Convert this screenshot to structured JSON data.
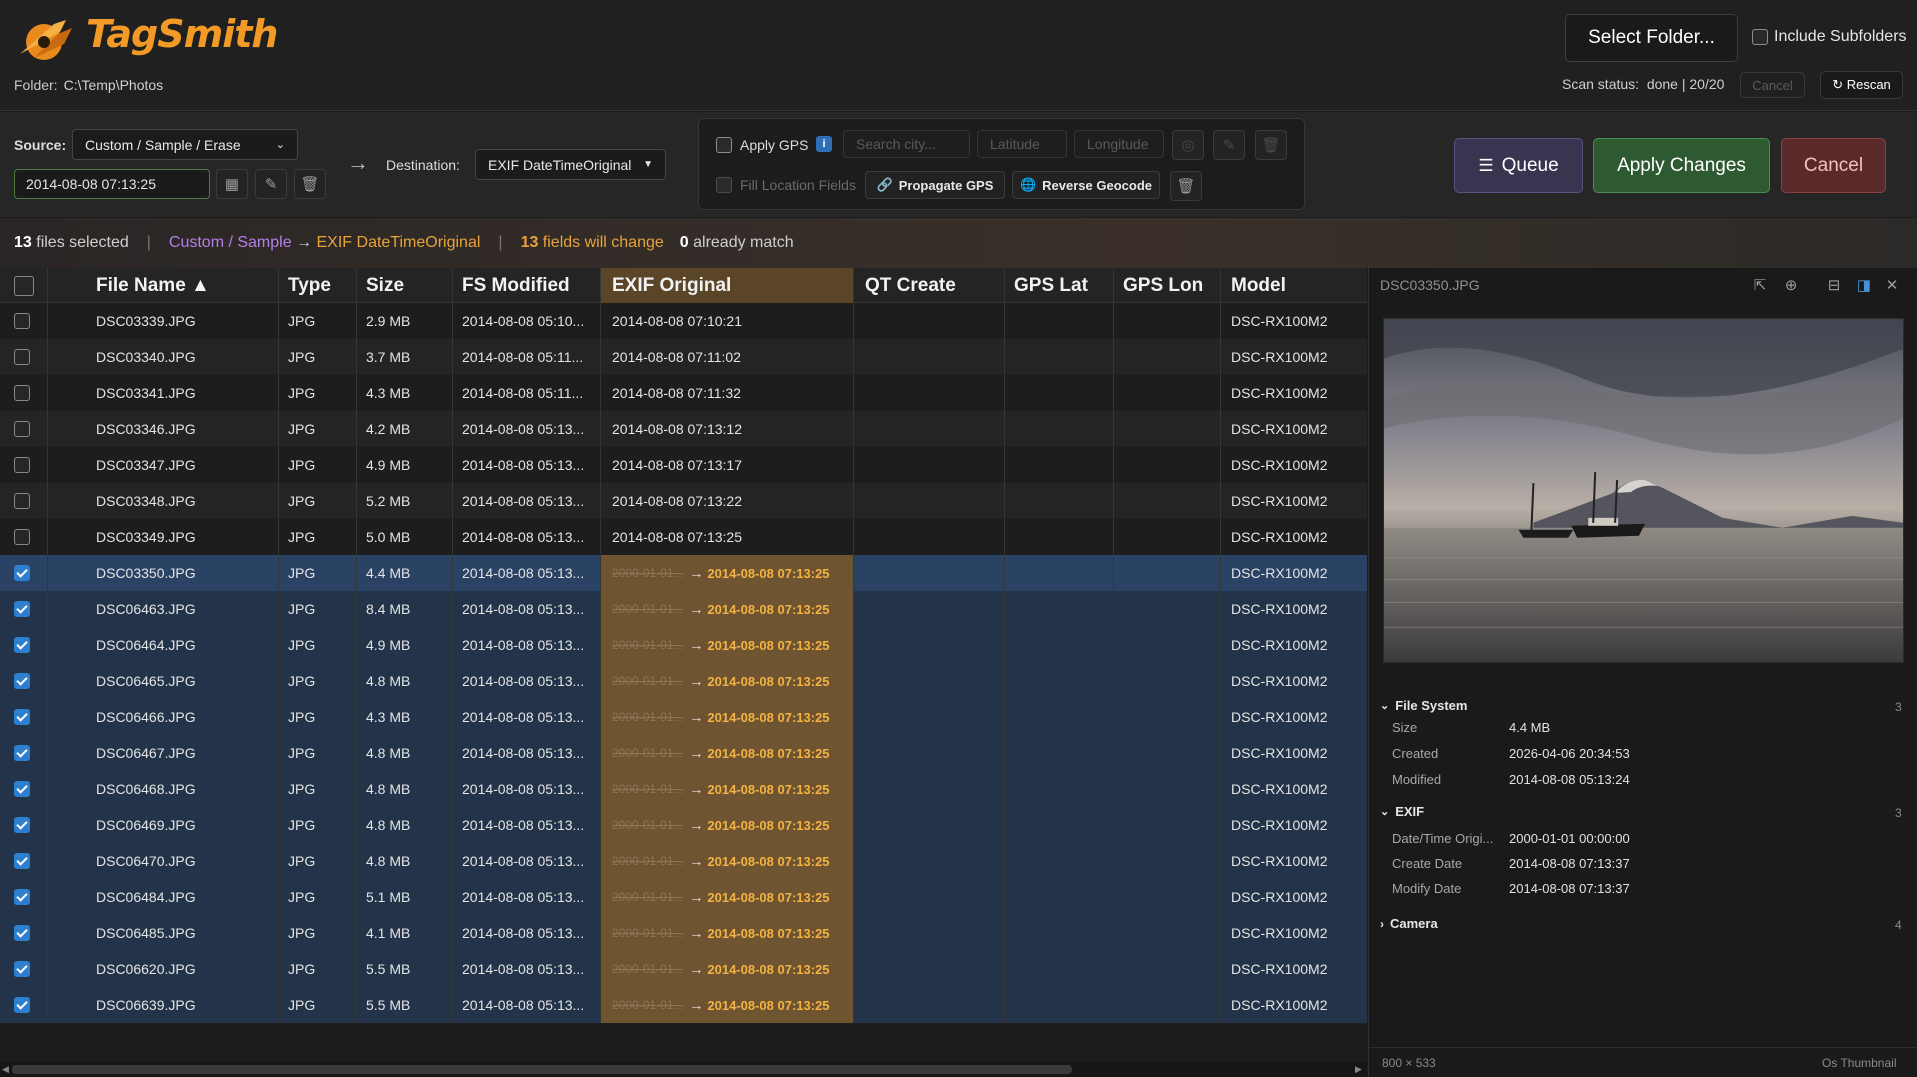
{
  "header": {
    "app_name": "TagSmith",
    "folder_label": "Folder:",
    "folder_path": "C:\\Temp\\Photos",
    "select_folder": "Select Folder...",
    "include_subfolders": "Include Subfolders",
    "scan_status": "Scan status:  done | 20/20",
    "scan_cancel": "Cancel",
    "rescan": "↻ Rescan"
  },
  "toolbar": {
    "source_label": "Source:",
    "source_value": "Custom / Sample / Erase",
    "date_value": "2014-08-08 07:13:25",
    "destination_label": "Destination:",
    "destination_value": "EXIF DateTimeOriginal",
    "apply_gps": "Apply GPS",
    "search_city": "Search city...",
    "latitude": "Latitude",
    "longitude": "Longitude",
    "fill_location": "Fill Location Fields",
    "propagate_gps": "Propagate GPS",
    "reverse_geocode": "Reverse Geocode",
    "queue": "Queue",
    "apply_changes": "Apply Changes",
    "cancel": "Cancel"
  },
  "summary": {
    "files_selected_count": "13",
    "files_selected_text": " files selected",
    "mapping_source": "Custom / Sample",
    "mapping_arrow": " → ",
    "mapping_dest": "EXIF DateTimeOriginal",
    "fields_change_count": "13",
    "fields_change_text": " fields will change",
    "match_count": "0",
    "match_text": " already match"
  },
  "table": {
    "columns": [
      "File Name ▲",
      "Type",
      "Size",
      "FS Modified",
      "EXIF Original",
      "QT Create",
      "GPS Lat",
      "GPS Lon",
      "Model"
    ],
    "old_value_prefix": "2000-01-01...",
    "new_value": "2014-08-08 07:13:25",
    "rows": [
      {
        "name": "DSC03339.JPG",
        "type": "JPG",
        "size": "2.9 MB",
        "fs": "2014-08-08 05:10...",
        "exif": "2014-08-08 07:10:21",
        "model": "DSC-RX100M2",
        "checked": false
      },
      {
        "name": "DSC03340.JPG",
        "type": "JPG",
        "size": "3.7 MB",
        "fs": "2014-08-08 05:11...",
        "exif": "2014-08-08 07:11:02",
        "model": "DSC-RX100M2",
        "checked": false
      },
      {
        "name": "DSC03341.JPG",
        "type": "JPG",
        "size": "4.3 MB",
        "fs": "2014-08-08 05:11...",
        "exif": "2014-08-08 07:11:32",
        "model": "DSC-RX100M2",
        "checked": false
      },
      {
        "name": "DSC03346.JPG",
        "type": "JPG",
        "size": "4.2 MB",
        "fs": "2014-08-08 05:13...",
        "exif": "2014-08-08 07:13:12",
        "model": "DSC-RX100M2",
        "checked": false
      },
      {
        "name": "DSC03347.JPG",
        "type": "JPG",
        "size": "4.9 MB",
        "fs": "2014-08-08 05:13...",
        "exif": "2014-08-08 07:13:17",
        "model": "DSC-RX100M2",
        "checked": false
      },
      {
        "name": "DSC03348.JPG",
        "type": "JPG",
        "size": "5.2 MB",
        "fs": "2014-08-08 05:13...",
        "exif": "2014-08-08 07:13:22",
        "model": "DSC-RX100M2",
        "checked": false
      },
      {
        "name": "DSC03349.JPG",
        "type": "JPG",
        "size": "5.0 MB",
        "fs": "2014-08-08 05:13...",
        "exif": "2014-08-08 07:13:25",
        "model": "DSC-RX100M2",
        "checked": false
      },
      {
        "name": "DSC03350.JPG",
        "type": "JPG",
        "size": "4.4 MB",
        "fs": "2014-08-08 05:13...",
        "exif": "change",
        "model": "DSC-RX100M2",
        "checked": true
      },
      {
        "name": "DSC06463.JPG",
        "type": "JPG",
        "size": "8.4 MB",
        "fs": "2014-08-08 05:13...",
        "exif": "change",
        "model": "DSC-RX100M2",
        "checked": true
      },
      {
        "name": "DSC06464.JPG",
        "type": "JPG",
        "size": "4.9 MB",
        "fs": "2014-08-08 05:13...",
        "exif": "change",
        "model": "DSC-RX100M2",
        "checked": true
      },
      {
        "name": "DSC06465.JPG",
        "type": "JPG",
        "size": "4.8 MB",
        "fs": "2014-08-08 05:13...",
        "exif": "change",
        "model": "DSC-RX100M2",
        "checked": true
      },
      {
        "name": "DSC06466.JPG",
        "type": "JPG",
        "size": "4.3 MB",
        "fs": "2014-08-08 05:13...",
        "exif": "change",
        "model": "DSC-RX100M2",
        "checked": true
      },
      {
        "name": "DSC06467.JPG",
        "type": "JPG",
        "size": "4.8 MB",
        "fs": "2014-08-08 05:13...",
        "exif": "change",
        "model": "DSC-RX100M2",
        "checked": true
      },
      {
        "name": "DSC06468.JPG",
        "type": "JPG",
        "size": "4.8 MB",
        "fs": "2014-08-08 05:13...",
        "exif": "change",
        "model": "DSC-RX100M2",
        "checked": true
      },
      {
        "name": "DSC06469.JPG",
        "type": "JPG",
        "size": "4.8 MB",
        "fs": "2014-08-08 05:13...",
        "exif": "change",
        "model": "DSC-RX100M2",
        "checked": true
      },
      {
        "name": "DSC06470.JPG",
        "type": "JPG",
        "size": "4.8 MB",
        "fs": "2014-08-08 05:13...",
        "exif": "change",
        "model": "DSC-RX100M2",
        "checked": true
      },
      {
        "name": "DSC06484.JPG",
        "type": "JPG",
        "size": "5.1 MB",
        "fs": "2014-08-08 05:13...",
        "exif": "change",
        "model": "DSC-RX100M2",
        "checked": true
      },
      {
        "name": "DSC06485.JPG",
        "type": "JPG",
        "size": "4.1 MB",
        "fs": "2014-08-08 05:13...",
        "exif": "change",
        "model": "DSC-RX100M2",
        "checked": true
      },
      {
        "name": "DSC06620.JPG",
        "type": "JPG",
        "size": "5.5 MB",
        "fs": "2014-08-08 05:13...",
        "exif": "change",
        "model": "DSC-RX100M2",
        "checked": true
      },
      {
        "name": "DSC06639.JPG",
        "type": "JPG",
        "size": "5.5 MB",
        "fs": "2014-08-08 05:13...",
        "exif": "change",
        "model": "DSC-RX100M2",
        "checked": true
      }
    ]
  },
  "preview": {
    "title": "DSC03350.JPG",
    "sections": {
      "file_system": {
        "title": "File System",
        "count": "3",
        "items": [
          [
            "Size",
            "4.4 MB"
          ],
          [
            "Created",
            "2026-04-06 20:34:53"
          ],
          [
            "Modified",
            "2014-08-08 05:13:24"
          ]
        ]
      },
      "exif": {
        "title": "EXIF",
        "count": "3",
        "items": [
          [
            "Date/Time Origi...",
            "2000-01-01 00:00:00"
          ],
          [
            "Create Date",
            "2014-08-08 07:13:37"
          ],
          [
            "Modify Date",
            "2014-08-08 07:13:37"
          ]
        ]
      },
      "camera": {
        "title": "Camera",
        "count": "4"
      }
    },
    "dimensions": "800 × 533",
    "thumb_source": "Os Thumbnail"
  },
  "colors": {
    "accent_orange": "#f29a25",
    "selection_blue": "#23344a",
    "exif_highlight": "#6e5430",
    "apply_green": "#2d5a30"
  }
}
